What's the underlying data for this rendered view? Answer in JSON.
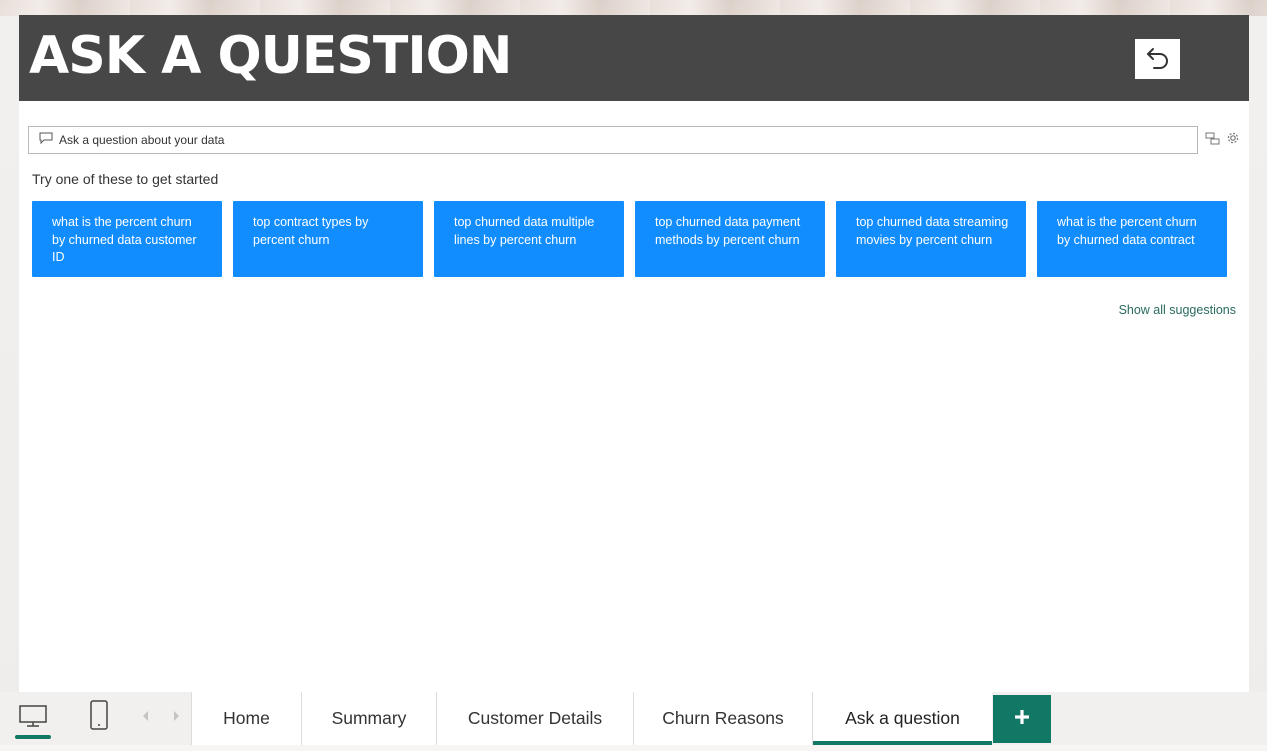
{
  "header": {
    "title": "ASK A QUESTION",
    "back_icon": "undo-arrow-icon"
  },
  "qa": {
    "placeholder": "Ask a question about your data",
    "value": "",
    "icons": [
      "chat-bubble-icon",
      "convert-visual-icon",
      "gear-icon"
    ]
  },
  "suggestions": {
    "prompt": "Try one of these to get started",
    "items": [
      "what is the percent churn by churned data customer ID",
      "top contract types by percent churn",
      "top churned data multiple lines by percent churn",
      "top churned data payment methods by percent churn",
      "top churned data streaming movies by percent churn",
      "what is the percent churn by churned data contract"
    ],
    "show_all": "Show all suggestions"
  },
  "tabbar": {
    "tabs": [
      {
        "label": "Home",
        "active": false
      },
      {
        "label": "Summary",
        "active": false
      },
      {
        "label": "Customer Details",
        "active": false
      },
      {
        "label": "Churn Reasons",
        "active": false
      },
      {
        "label": "Ask a question",
        "active": true
      }
    ],
    "add_label": "+",
    "icons": [
      "desktop-view-icon",
      "mobile-view-icon",
      "chevron-left-icon",
      "chevron-right-icon",
      "plus-icon"
    ]
  },
  "colors": {
    "header_bg": "#474747",
    "suggestion_bg": "#118dff",
    "accent": "#117865",
    "link": "#2a6a5f"
  }
}
